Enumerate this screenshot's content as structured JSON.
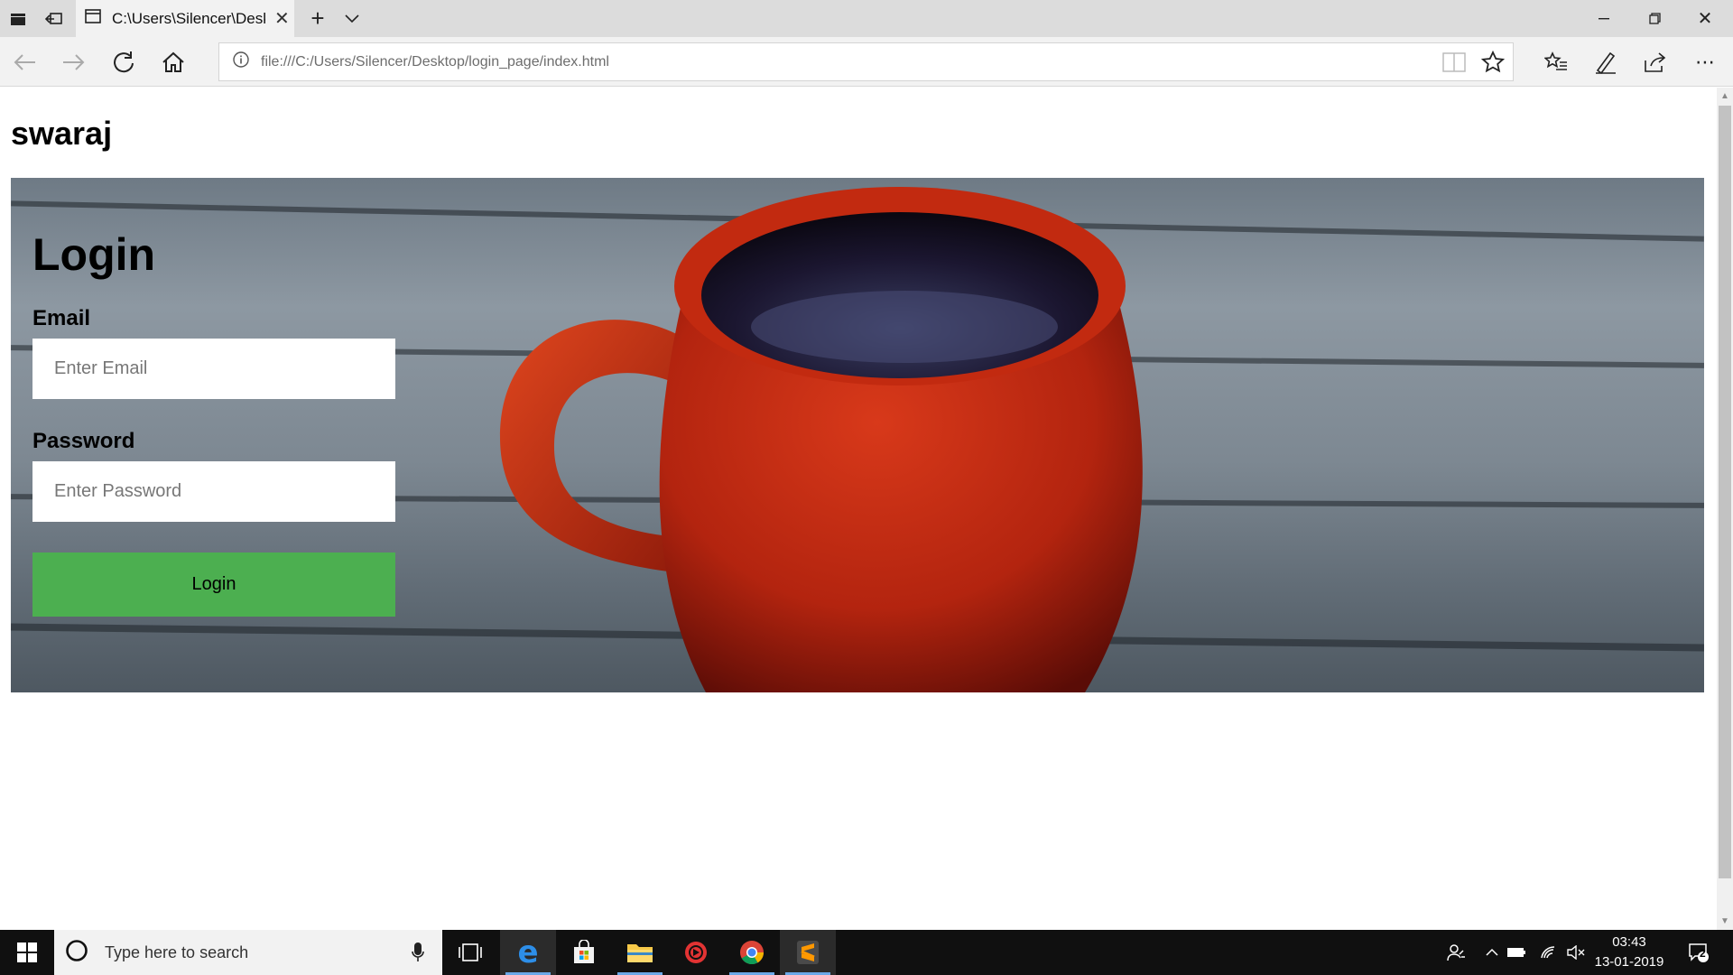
{
  "browser": {
    "tab_title": "C:\\Users\\Silencer\\Deskt",
    "url": "file:///C:/Users/Silencer/Desktop/login_page/index.html"
  },
  "page": {
    "site_title": "swaraj",
    "login_title": "Login",
    "email_label": "Email",
    "email_placeholder": "Enter Email",
    "password_label": "Password",
    "password_placeholder": "Enter Password",
    "login_button": "Login",
    "accent_color": "#4caf50"
  },
  "taskbar": {
    "search_placeholder": "Type here to search",
    "time": "03:43",
    "date": "13-01-2019",
    "notification_count": "2",
    "apps": [
      "task-view-icon",
      "edge-icon",
      "store-icon",
      "file-explorer-icon",
      "media-app-icon",
      "chrome-icon",
      "sublime-text-icon"
    ]
  }
}
